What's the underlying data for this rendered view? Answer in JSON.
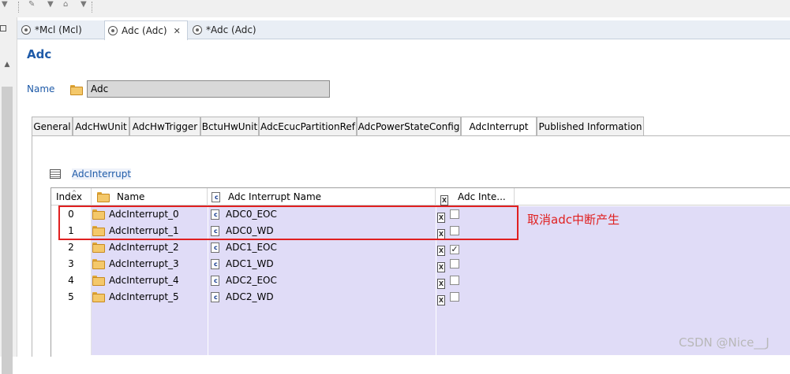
{
  "editor_tabs": [
    {
      "label": "*Mcl (Mcl)",
      "active": false,
      "closable": false
    },
    {
      "label": "Adc (Adc)",
      "active": true,
      "closable": true
    },
    {
      "label": "*Adc (Adc)",
      "active": false,
      "closable": false
    }
  ],
  "close_glyph": "✕",
  "editor_title": "Adc",
  "name_field": {
    "label": "Name",
    "value": "Adc"
  },
  "page_tabs": [
    {
      "label": "General",
      "active": false
    },
    {
      "label": "AdcHwUnit",
      "active": false
    },
    {
      "label": "AdcHwTrigger",
      "active": false
    },
    {
      "label": "BctuHwUnit",
      "active": false
    },
    {
      "label": "AdcEcucPartitionRef",
      "active": false
    },
    {
      "label": "AdcPowerStateConfig",
      "active": false
    },
    {
      "label": "AdcInterrupt",
      "active": true
    },
    {
      "label": "Published Information",
      "active": false
    }
  ],
  "table_title": "AdcInterrupt",
  "table": {
    "columns": [
      "Index",
      "Name",
      "Adc Interrupt Name",
      "Adc Inte..."
    ],
    "rows": [
      {
        "index": "0",
        "name": "AdcInterrupt_0",
        "interrupt_name": "ADC0_EOC",
        "checked": false
      },
      {
        "index": "1",
        "name": "AdcInterrupt_1",
        "interrupt_name": "ADC0_WD",
        "checked": false
      },
      {
        "index": "2",
        "name": "AdcInterrupt_2",
        "interrupt_name": "ADC1_EOC",
        "checked": true
      },
      {
        "index": "3",
        "name": "AdcInterrupt_3",
        "interrupt_name": "ADC1_WD",
        "checked": false
      },
      {
        "index": "4",
        "name": "AdcInterrupt_4",
        "interrupt_name": "ADC2_EOC",
        "checked": false
      },
      {
        "index": "5",
        "name": "AdcInterrupt_5",
        "interrupt_name": "ADC2_WD",
        "checked": false
      }
    ],
    "empty_rows": 3
  },
  "annotation": "取消adc中断产生",
  "watermark": "CSDN @Nice__J",
  "colors": {
    "accent": "#1e5aa8",
    "row_fill": "#e0dcf7",
    "annotation_red": "#e02020"
  }
}
